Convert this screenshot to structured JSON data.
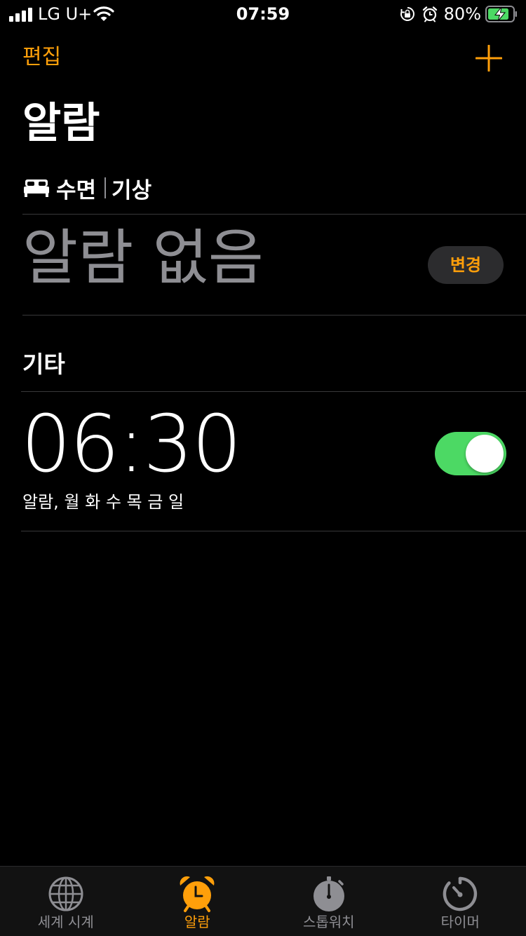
{
  "status_bar": {
    "carrier": "LG U+",
    "time": "07:59",
    "battery_percent": "80%",
    "icons": [
      "signal-icon",
      "wifi-icon",
      "orientation-lock-icon",
      "alarm-clock-icon",
      "battery-charging-icon"
    ]
  },
  "nav": {
    "edit_label": "편집",
    "add_icon": "plus-icon"
  },
  "page": {
    "title": "알람"
  },
  "sleep_wake": {
    "icon": "bed-icon",
    "sleep_label": "수면",
    "wake_label": "기상",
    "no_alarm_text": "알람 없음",
    "change_button_label": "변경"
  },
  "other": {
    "section_title": "기타",
    "alarms": [
      {
        "time": "06:30",
        "label": "알람, 월 화 수 목 금 일",
        "enabled": true
      }
    ]
  },
  "tab_bar": {
    "active_index": 1,
    "tabs": [
      {
        "label": "세계 시계",
        "icon": "globe-icon"
      },
      {
        "label": "알람",
        "icon": "alarm-clock-icon"
      },
      {
        "label": "스톱워치",
        "icon": "stopwatch-icon"
      },
      {
        "label": "타이머",
        "icon": "timer-icon"
      }
    ]
  },
  "colors": {
    "accent": "#ff9f0a",
    "toggle_on": "#4cd964",
    "secondary_text": "#8e8e93",
    "background": "#000000"
  }
}
